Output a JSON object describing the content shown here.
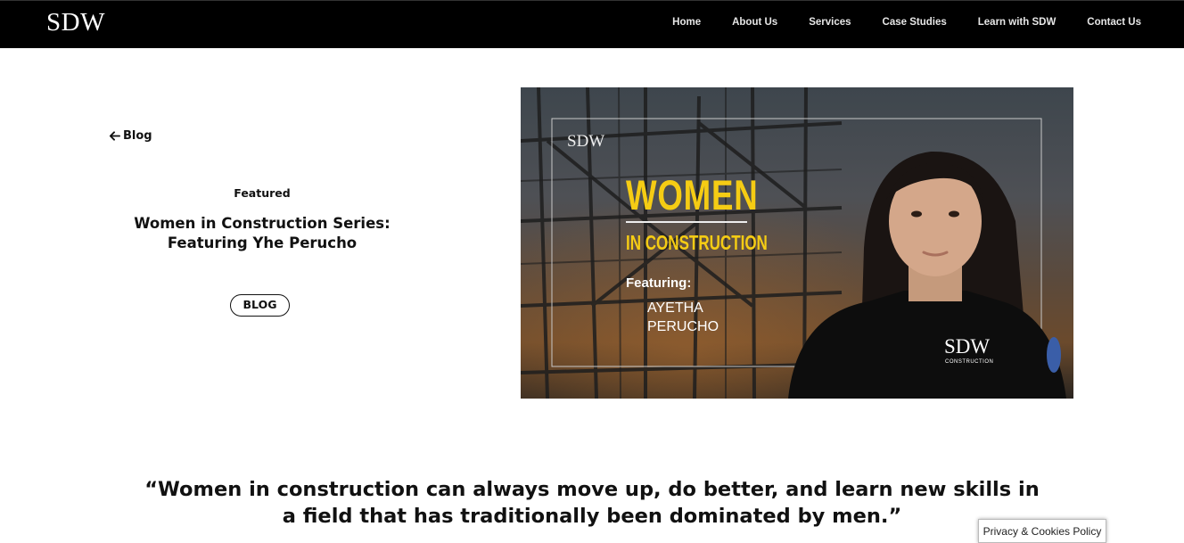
{
  "brand": "SDW",
  "nav": [
    "Home",
    "About Us",
    "Services",
    "Case Studies",
    "Learn with SDW",
    "Contact Us"
  ],
  "back_label": "Blog",
  "featured_label": "Featured",
  "post_title": "Women in Construction Series: Featuring Yhe Perucho",
  "category_pill": "BLOG",
  "hero": {
    "small_logo": "SDW",
    "headline": "WOMEN",
    "subheadline": "IN CONSTRUCTION",
    "featuring_label": "Featuring:",
    "name_line1": "AYETHA",
    "name_line2": "PERUCHO",
    "shirt_logo": "SDW",
    "shirt_logo_sub": "CONSTRUCTION",
    "accent_color": "#f5cc14"
  },
  "quote": "“Women in construction can always move up, do better, and learn new skills in a field that has traditionally been dominated by men.”",
  "cookie_label": "Privacy & Cookies Policy"
}
